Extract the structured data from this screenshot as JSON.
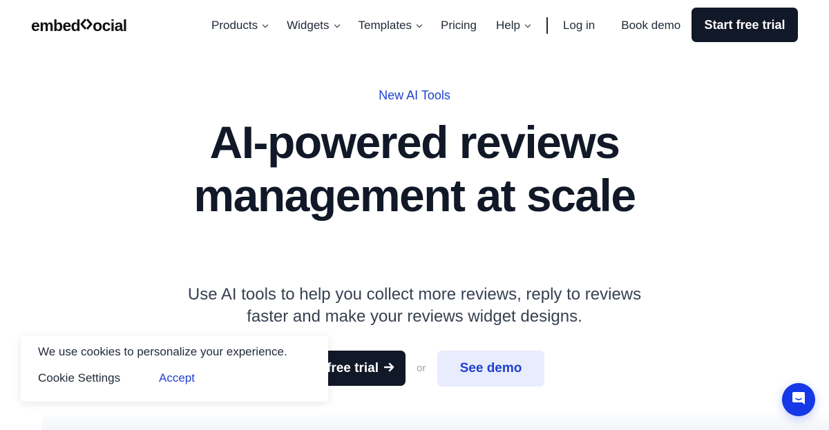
{
  "header": {
    "logo_left": "embed",
    "logo_right": "ocial",
    "nav": [
      {
        "label": "Products",
        "has_dropdown": true
      },
      {
        "label": "Widgets",
        "has_dropdown": true
      },
      {
        "label": "Templates",
        "has_dropdown": true
      },
      {
        "label": "Pricing",
        "has_dropdown": false
      },
      {
        "label": "Help",
        "has_dropdown": true
      }
    ],
    "login_label": "Log in",
    "book_demo_label": "Book demo",
    "start_trial_label": "Start free trial"
  },
  "hero": {
    "eyebrow": "New AI Tools",
    "title": "AI-powered reviews management at scale",
    "subtitle": "Use AI tools to help you collect more reviews, reply to reviews faster and make your reviews widget designs.",
    "primary_cta": "Start free trial",
    "primary_cta_visible": "free trial",
    "primary_cta_icon": "arrow-right-icon",
    "separator": "or",
    "secondary_cta": "See demo"
  },
  "cookie_banner": {
    "message": "We use cookies to personalize your experience.",
    "settings_label": "Cookie Settings",
    "accept_label": "Accept"
  },
  "chat_widget": {
    "icon": "chat-smile-icon"
  },
  "colors": {
    "primary_dark": "#111827",
    "accent_blue": "#1d3fd1",
    "demo_button_bg": "#e8ecfd",
    "chat_blue": "#1539e6"
  }
}
